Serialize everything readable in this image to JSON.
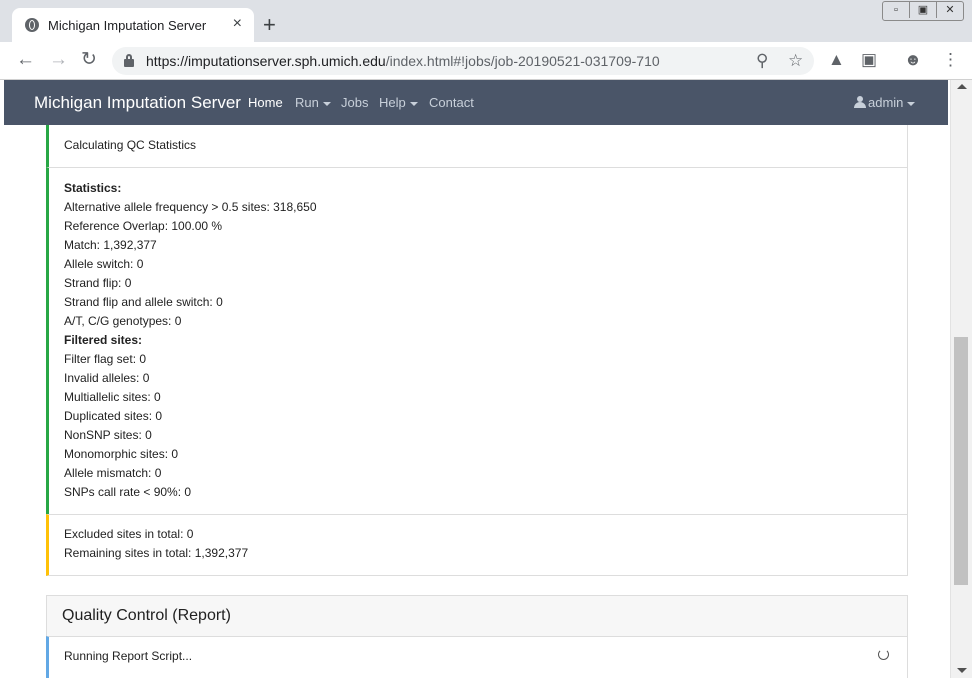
{
  "browser": {
    "tab_title": "Michigan Imputation Server",
    "tab_close": "×",
    "new_tab": "+",
    "url_host": "https://imputationserver.sph.umich.edu",
    "url_path": "/index.html#!jobs/job-20190521-031709-710"
  },
  "navbar": {
    "brand": "Michigan Imputation Server",
    "items": [
      {
        "label": "Home",
        "active": true
      },
      {
        "label": "Run",
        "dropdown": true
      },
      {
        "label": "Jobs"
      },
      {
        "label": "Help",
        "dropdown": true
      },
      {
        "label": "Contact"
      }
    ],
    "user": "admin"
  },
  "qc_steps": {
    "calculating": "Calculating QC Statistics",
    "statistics_lines": [
      {
        "text": "Statistics:",
        "bold": true
      },
      {
        "text": "Alternative allele frequency > 0.5 sites: 318,650"
      },
      {
        "text": "Reference Overlap: 100.00 %"
      },
      {
        "text": "Match: 1,392,377"
      },
      {
        "text": "Allele switch: 0"
      },
      {
        "text": "Strand flip: 0"
      },
      {
        "text": "Strand flip and allele switch: 0"
      },
      {
        "text": "A/T, C/G genotypes: 0"
      },
      {
        "text": "Filtered sites:",
        "bold": true
      },
      {
        "text": "Filter flag set: 0"
      },
      {
        "text": "Invalid alleles: 0"
      },
      {
        "text": "Multiallelic sites: 0"
      },
      {
        "text": "Duplicated sites: 0"
      },
      {
        "text": "NonSNP sites: 0"
      },
      {
        "text": "Monomorphic sites: 0"
      },
      {
        "text": "Allele mismatch: 0"
      },
      {
        "text": "SNPs call rate < 90%: 0"
      }
    ],
    "summary_lines": [
      "Excluded sites in total: 0",
      "Remaining sites in total: 1,392,377"
    ]
  },
  "report": {
    "title": "Quality Control (Report)",
    "status": "Running Report Script..."
  },
  "colors": {
    "navbar": "#4a5568",
    "success_border": "#28a745",
    "warning_border": "#ffc107",
    "info_border": "#62a8e5"
  }
}
